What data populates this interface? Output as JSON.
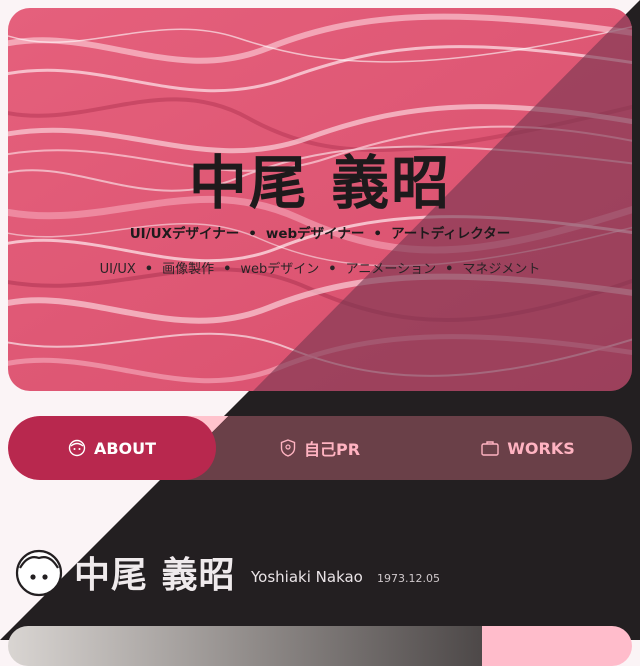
{
  "hero": {
    "name": "中尾 義昭",
    "roles": [
      "UI/UXデザイナー",
      "webデザイナー",
      "アートディレクター"
    ],
    "skills": [
      "UI/UX",
      "画像製作",
      "webデザイン",
      "アニメーション",
      "マネジメント"
    ],
    "separator": "•"
  },
  "nav": {
    "items": [
      {
        "label": "ABOUT",
        "icon": "face-icon",
        "active": true
      },
      {
        "label": "自己PR",
        "icon": "shield-icon",
        "active": false
      },
      {
        "label": "WORKS",
        "icon": "briefcase-icon",
        "active": false
      }
    ]
  },
  "profile": {
    "name": "中尾 義昭",
    "romaji": "Yoshiaki Nakao",
    "birthdate": "1973.12.05",
    "avatar_icon": "face-avatar-icon"
  },
  "colors": {
    "hero_pink": "#e25a78",
    "active_tab": "#b8284e",
    "tab_text": "#ffb3c1",
    "dark_bg": "#231f21"
  }
}
